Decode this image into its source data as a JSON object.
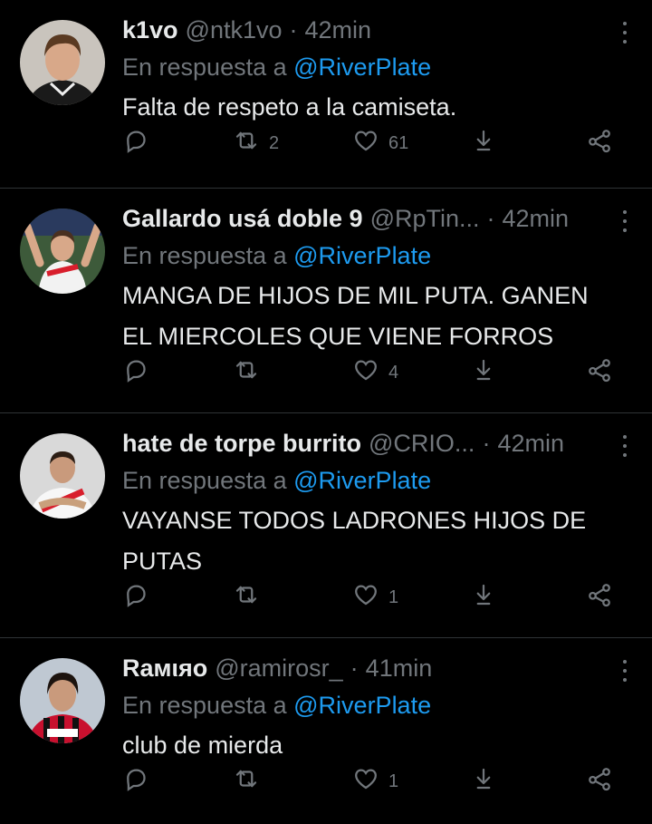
{
  "colors": {
    "background": "#000000",
    "text": "#e7e9ea",
    "muted": "#71767b",
    "link": "#1d9bf0",
    "divider": "#2f3336"
  },
  "tweets": [
    {
      "name": "k1vo",
      "handle": "@ntk1vo",
      "separator": "·",
      "time": "42min",
      "reply_prefix": "En respuesta a",
      "reply_to": "@RiverPlate",
      "lines": [
        "Falta de respeto a la camiseta."
      ],
      "retweets": "2",
      "likes": "61",
      "avatar": "black-goalkeeper-jersey"
    },
    {
      "name": "Gallardo usá doble 9",
      "handle": "@RpTin...",
      "separator": "·",
      "time": "42min",
      "reply_prefix": "En respuesta a",
      "reply_to": "@RiverPlate",
      "lines": [
        "MANGA DE HIJOS DE MIL PUTA. GANEN",
        "EL MIERCOLES QUE VIENE FORROS"
      ],
      "retweets": "",
      "likes": "4",
      "avatar": "player-arms-raised"
    },
    {
      "name": "hate de torpe burrito",
      "handle": "@CRIO...",
      "separator": "·",
      "time": "42min",
      "reply_prefix": "En respuesta a",
      "reply_to": "@RiverPlate",
      "lines": [
        "VAYANSE TODOS LADRONES HIJOS DE",
        "PUTAS"
      ],
      "retweets": "",
      "likes": "1",
      "avatar": "player-white-jersey"
    },
    {
      "name": "Rамιяо",
      "handle": "@ramirosr_",
      "separator": "·",
      "time": "41min",
      "reply_prefix": "En respuesta a",
      "reply_to": "@RiverPlate",
      "lines": [
        "club de mierda"
      ],
      "retweets": "",
      "likes": "1",
      "avatar": "player-striped-jersey"
    }
  ]
}
